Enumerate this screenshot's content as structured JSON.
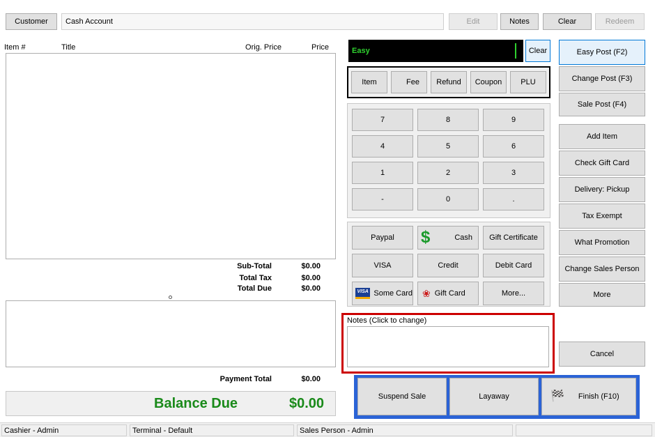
{
  "header": {
    "customer_label": "Customer",
    "account_value": "Cash Account",
    "edit_label": "Edit",
    "notes_label": "Notes",
    "clear_label": "Clear",
    "redeem_label": "Redeem"
  },
  "items_table": {
    "columns": [
      "Item #",
      "Title",
      "Orig. Price",
      "Price"
    ]
  },
  "totals": {
    "subtotal_label": "Sub-Total",
    "subtotal_value": "$0.00",
    "tax_label": "Total Tax",
    "tax_value": "$0.00",
    "due_label": "Total Due",
    "due_value": "$0.00"
  },
  "payment": {
    "total_label": "Payment Total",
    "total_value": "$0.00",
    "balance_label": "Balance Due",
    "balance_value": "$0.00"
  },
  "entry": {
    "mode_text": "Easy",
    "clear_label": "Clear"
  },
  "entry_types": [
    "Item",
    "Fee",
    "Refund",
    "Coupon",
    "PLU"
  ],
  "keypad": [
    "7",
    "8",
    "9",
    "4",
    "5",
    "6",
    "1",
    "2",
    "3",
    "-",
    "0",
    "."
  ],
  "tenders": {
    "paypal": "Paypal",
    "cash": "Cash",
    "gift_certificate": "Gift Certificate",
    "visa": "VISA",
    "credit": "Credit",
    "debit": "Debit Card",
    "some_card": "Some Card",
    "gift_card": "Gift Card",
    "more": "More..."
  },
  "notes": {
    "label": "Notes (Click to change)"
  },
  "actions": {
    "easy_post": "Easy Post (F2)",
    "change_post": "Change Post (F3)",
    "sale_post": "Sale Post (F4)",
    "add_item": "Add Item",
    "check_gift_card": "Check Gift Card",
    "delivery": "Delivery: Pickup",
    "tax_exempt": "Tax Exempt",
    "what_promotion": "What Promotion",
    "change_sales_person": "Change Sales Person",
    "more": "More",
    "cancel": "Cancel"
  },
  "bottom_actions": {
    "suspend": "Suspend Sale",
    "layaway": "Layaway",
    "finish": "Finish (F10)"
  },
  "status": {
    "cashier": "Cashier - Admin",
    "terminal": "Terminal - Default",
    "sales_person": "Sales Person - Admin"
  },
  "colors": {
    "accent_green": "#1a8a1a",
    "entry_text_green": "#2fd12f",
    "highlight_red": "#cc0000",
    "bottom_bar_blue": "#2b63d6",
    "selected_blue": "#0078d7"
  }
}
